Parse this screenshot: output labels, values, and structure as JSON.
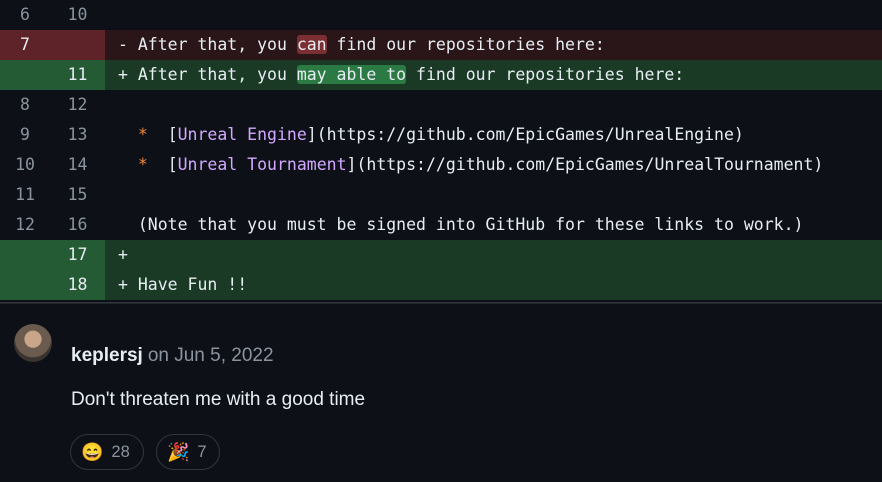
{
  "diff": {
    "rows": [
      {
        "type": "ctx",
        "old": "6",
        "new": "10",
        "code": ""
      },
      {
        "type": "del",
        "old": "7",
        "new": "",
        "prefix": "- After that, you ",
        "highlight": "can",
        "suffix": " find our repositories here:"
      },
      {
        "type": "add",
        "old": "",
        "new": "11",
        "prefix": "+ After that, you ",
        "highlight": "may able to",
        "suffix": " find our repositories here:"
      },
      {
        "type": "ctx",
        "old": "8",
        "new": "12",
        "code": ""
      },
      {
        "type": "ctx",
        "old": "9",
        "new": "13",
        "bullet": "*",
        "open": "[",
        "link": "Unreal Engine",
        "close": "](https://github.com/EpicGames/UnrealEngine)"
      },
      {
        "type": "ctx",
        "old": "10",
        "new": "14",
        "bullet": "*",
        "open": "[",
        "link": "Unreal Tournament",
        "close": "](https://github.com/EpicGames/UnrealTournament)"
      },
      {
        "type": "ctx",
        "old": "11",
        "new": "15",
        "code": ""
      },
      {
        "type": "ctx",
        "old": "12",
        "new": "16",
        "code": "  (Note that you must be signed into GitHub for these links to work.)"
      },
      {
        "type": "add",
        "old": "",
        "new": "17",
        "code": "+"
      },
      {
        "type": "add",
        "old": "",
        "new": "18",
        "code": "+ Have Fun !!"
      }
    ]
  },
  "comment": {
    "author": "keplersj",
    "date": "on Jun 5, 2022",
    "body": "Don't threaten me with a good time",
    "reactions": [
      {
        "emoji": "😄",
        "count": "28",
        "icon": "grinning-face-icon"
      },
      {
        "emoji": "🎉",
        "count": "7",
        "icon": "party-popper-icon"
      }
    ]
  },
  "colors": {
    "background": "#0d1117",
    "deletion_bg": "#2a1618",
    "addition_bg": "#1b3a26",
    "link": "#d2a8ff",
    "bullet": "#f0883e"
  }
}
